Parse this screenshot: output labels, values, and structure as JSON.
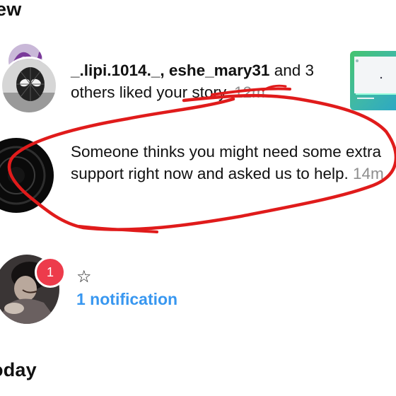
{
  "sections": {
    "new_label": "ew",
    "today_label": "oday"
  },
  "story_like": {
    "usernames": "_.lipi.1014._, eshe_mary31",
    "text_after": " and 3 others liked your story.",
    "time": "12m"
  },
  "support": {
    "text": "Someone thinks you might need some extra support right now and asked us to help.",
    "time": "14m"
  },
  "notification_group": {
    "badge_count": "1",
    "star": "☆",
    "link_label": "1 notification"
  },
  "colors": {
    "link": "#3897f0",
    "badge": "#ed3b4b",
    "scribble": "#e01b1b",
    "time": "#8e8e8e"
  },
  "icons": [
    "spiderman-avatar",
    "dark-ring-avatar",
    "photo-avatar",
    "story-thumbnail",
    "star-icon"
  ]
}
